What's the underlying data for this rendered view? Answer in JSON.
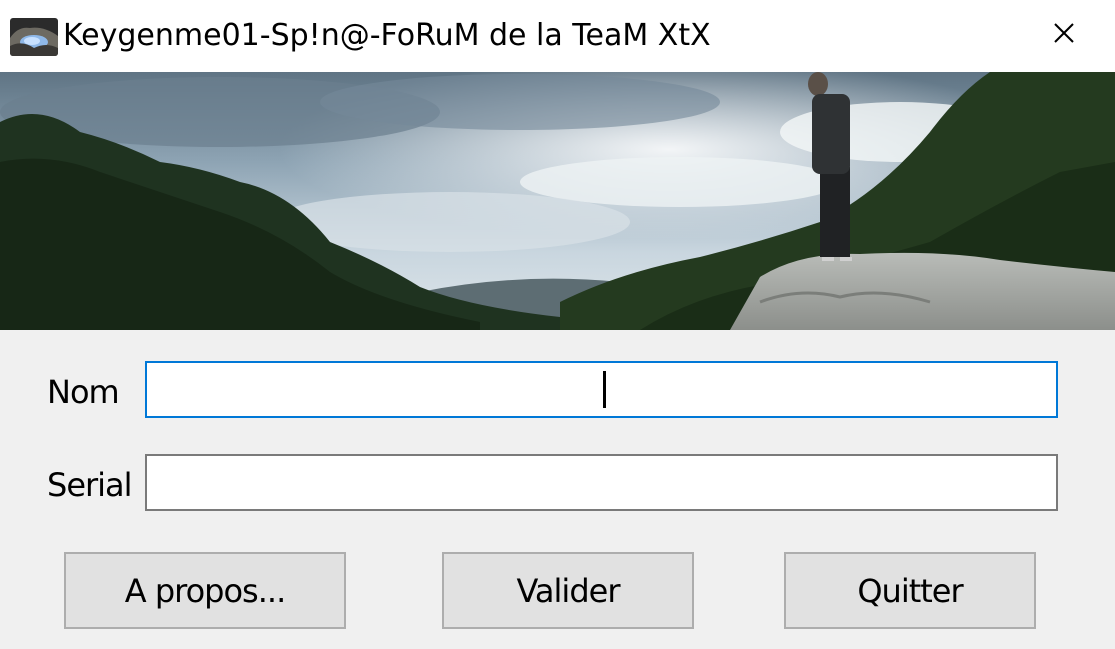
{
  "window": {
    "title": "Keygenme01-Sp!n@-FoRuM de la TeaM XtX",
    "icon": "landscape-thumbnail-icon",
    "close_icon": "close-icon"
  },
  "banner": {
    "description_icon": "landscape-photo"
  },
  "form": {
    "nom_label": "Nom",
    "nom_value": "",
    "serial_label": "Serial",
    "serial_value": ""
  },
  "buttons": {
    "apropos_label": "A propos...",
    "valider_label": "Valider",
    "quitter_label": "Quitter"
  },
  "colors": {
    "focus_border": "#0078d7",
    "button_face": "#e1e1e1",
    "window_bg": "#f0f0f0"
  }
}
